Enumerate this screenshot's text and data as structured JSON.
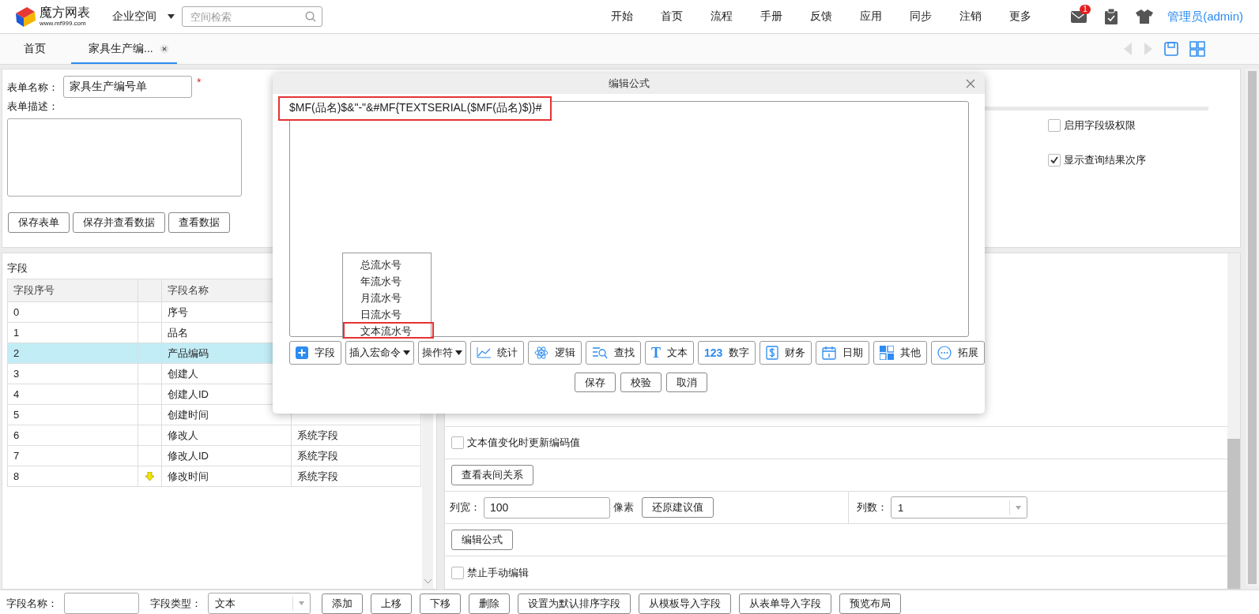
{
  "header": {
    "logo_name": "魔方网表",
    "logo_url": "www.mf999.com",
    "space": "企业空间",
    "search": {
      "placeholder": "空间检索"
    },
    "nav": [
      "开始",
      "首页",
      "流程",
      "手册",
      "反馈",
      "应用",
      "同步",
      "注销",
      "更多"
    ],
    "mail_badge": "1",
    "user": "管理员(admin)"
  },
  "tabs": [
    {
      "label": "首页",
      "selected": false,
      "closable": false
    },
    {
      "label": "家具生产编...",
      "selected": true,
      "closable": true
    }
  ],
  "form": {
    "name_label": "表单名称：",
    "name_value": "家具生产编号单",
    "required_mark": "*",
    "desc_label": "表单描述：",
    "buttons": [
      "保存表单",
      "保存并查看数据",
      "查看数据"
    ],
    "options": [
      {
        "label": "启用字段级权限",
        "checked": false
      },
      {
        "label": "显示查询结果次序",
        "checked": true
      }
    ]
  },
  "fields": {
    "title": "字段",
    "columns": [
      "字段序号",
      "字段名称"
    ],
    "rows": [
      {
        "index": "0",
        "name": "序号",
        "selected": false,
        "arrow": false
      },
      {
        "index": "1",
        "name": "品名",
        "selected": false,
        "arrow": false
      },
      {
        "index": "2",
        "name": "产品编码",
        "selected": true,
        "arrow": false
      },
      {
        "index": "3",
        "name": "创建人",
        "selected": false,
        "arrow": false
      },
      {
        "index": "4",
        "name": "创建人ID",
        "selected": false,
        "arrow": false
      },
      {
        "index": "5",
        "name": "创建时间",
        "selected": false,
        "arrow": false
      },
      {
        "index": "6",
        "name": "修改人",
        "type": "系统字段",
        "selected": false,
        "arrow": false
      },
      {
        "index": "7",
        "name": "修改人ID",
        "type": "系统字段",
        "selected": false,
        "arrow": false
      },
      {
        "index": "8",
        "name": "修改时间",
        "type": "系统字段",
        "selected": false,
        "arrow": true
      }
    ]
  },
  "properties": {
    "update_on_change": {
      "label": "文本值变化时更新编码值",
      "checked": false
    },
    "relation_button": "查看表间关系",
    "width_label": "列宽：",
    "width_value": "100",
    "unit": "像素",
    "reset_button": "还原建议值",
    "columns_label": "列数：",
    "columns_value": "1",
    "formula_button": "编辑公式",
    "no_manual_edit": {
      "label": "禁止手动编辑",
      "checked": false
    }
  },
  "bottom_bar": {
    "name_label": "字段名称：",
    "type_label": "字段类型：",
    "type_value": "文本",
    "buttons": [
      "添加",
      "上移",
      "下移",
      "删除",
      "设置为默认排序字段",
      "从模板导入字段",
      "从表单导入字段",
      "预览布局"
    ]
  },
  "dialog": {
    "title": "编辑公式",
    "formula": "$MF(品名)$&\"-\"&#MF{TEXTSERIAL($MF(品名)$)}#",
    "menu": [
      {
        "label": "总流水号",
        "selected": false
      },
      {
        "label": "年流水号",
        "selected": false
      },
      {
        "label": "月流水号",
        "selected": false
      },
      {
        "label": "日流水号",
        "selected": false
      },
      {
        "label": "文本流水号",
        "selected": true
      }
    ],
    "toolbar": [
      {
        "kind": "plus",
        "label": "字段"
      },
      {
        "kind": "menu",
        "label": "插入宏命令"
      },
      {
        "kind": "menu",
        "label": "操作符"
      },
      {
        "kind": "chart",
        "label": "统计"
      },
      {
        "kind": "atom",
        "label": "逻辑"
      },
      {
        "kind": "find",
        "label": "查找"
      },
      {
        "kind": "glyph",
        "glyph": "T",
        "label": "文本"
      },
      {
        "kind": "glyph",
        "glyph": "123",
        "label": "数字"
      },
      {
        "kind": "dollar",
        "label": "财务"
      },
      {
        "kind": "calendar",
        "label": "日期"
      },
      {
        "kind": "grid",
        "label": "其他"
      },
      {
        "kind": "dots",
        "label": "拓展"
      }
    ],
    "buttons": [
      "保存",
      "校验",
      "取消"
    ]
  }
}
